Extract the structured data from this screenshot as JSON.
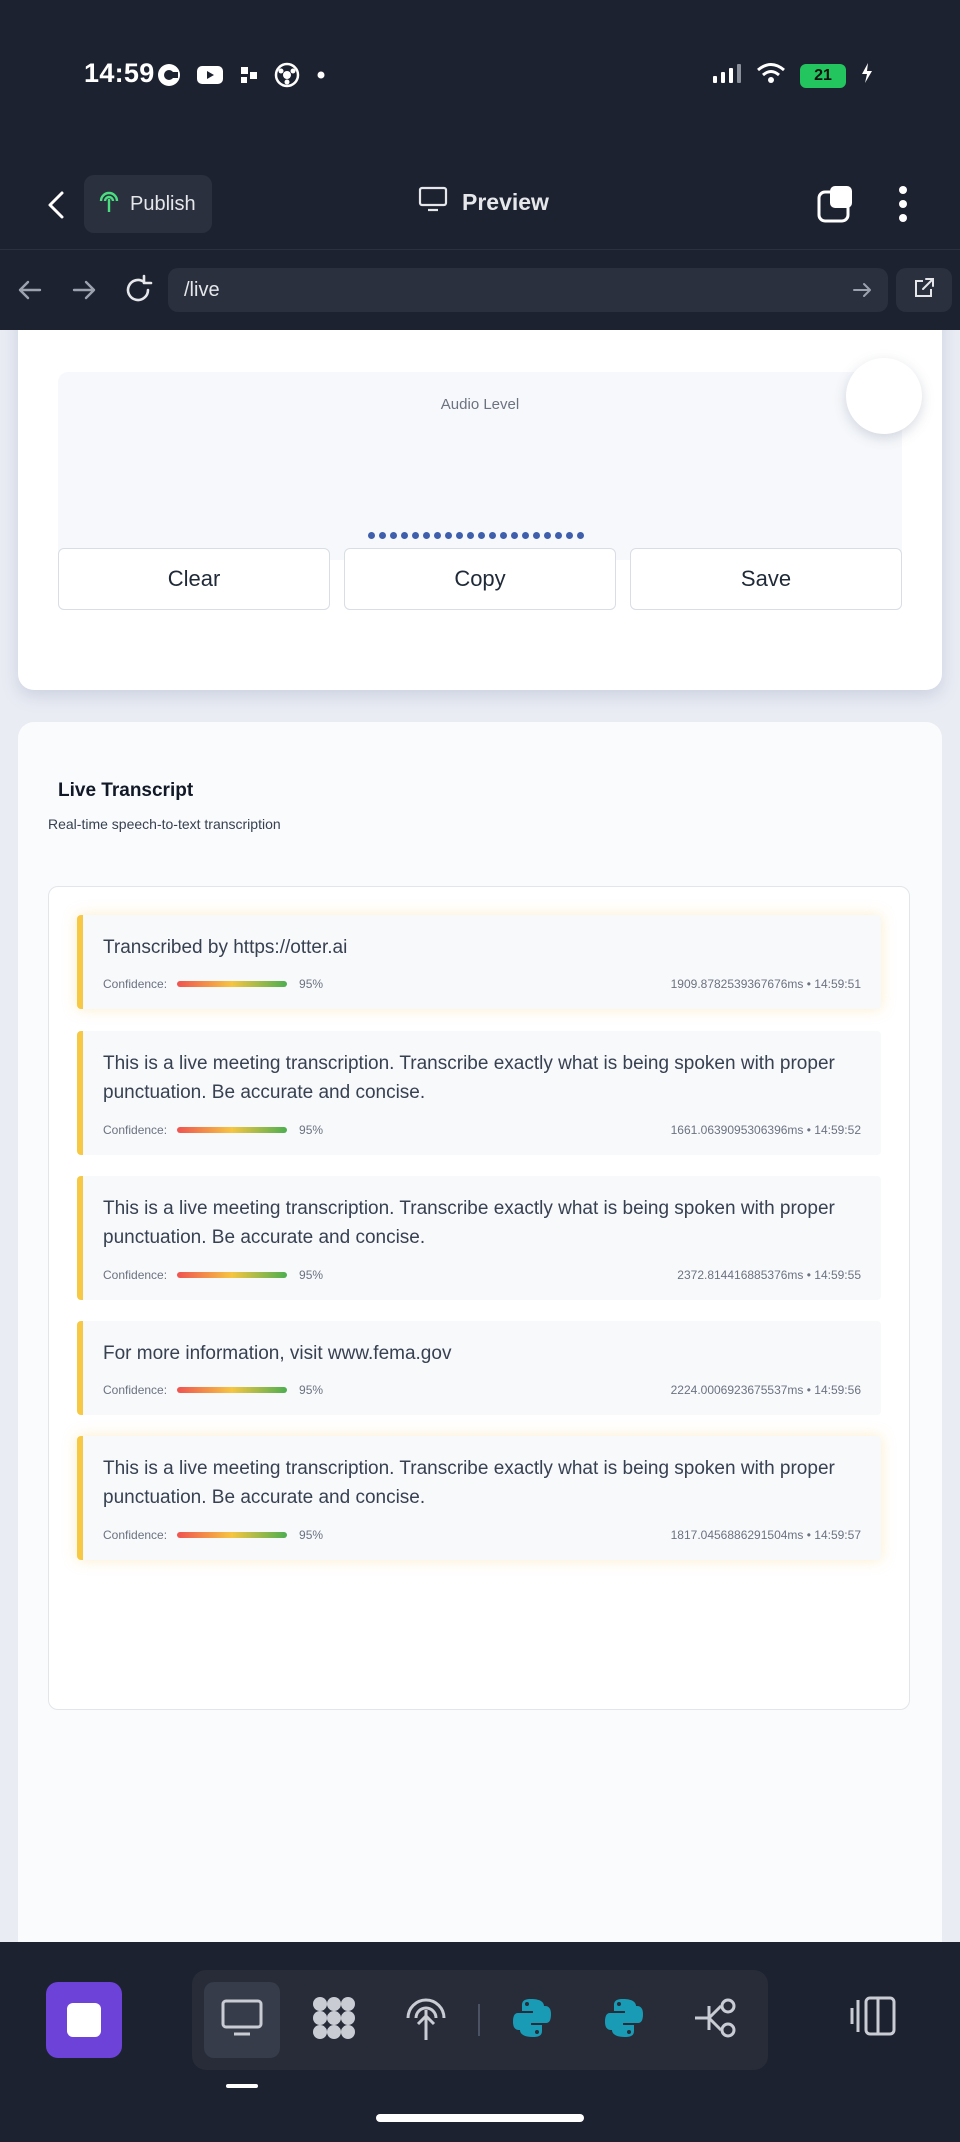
{
  "status_bar": {
    "time": "14:59",
    "battery": "21",
    "icons": [
      "threads-icon",
      "youtube-icon",
      "app-icon",
      "soccer-icon",
      "dot-icon",
      "signal-icon",
      "wifi-icon",
      "battery-icon"
    ]
  },
  "toolbar": {
    "publish_label": "Publish",
    "preview_label": "Preview"
  },
  "browser": {
    "url": "/live"
  },
  "audio": {
    "label": "Audio Level"
  },
  "actions": {
    "clear": "Clear",
    "copy": "Copy",
    "save": "Save"
  },
  "transcript": {
    "title": "Live Transcript",
    "subtitle": "Real-time speech-to-text transcription",
    "confidence_label": "Confidence:",
    "segments": [
      {
        "text": "Transcribed by https://otter.ai",
        "confidence": "95%",
        "meta": "1909.8782539367676ms • 14:59:51"
      },
      {
        "text": "This is a live meeting transcription. Transcribe exactly what is being spoken with proper punctuation. Be accurate and concise.",
        "confidence": "95%",
        "meta": "1661.0639095306396ms • 14:59:52"
      },
      {
        "text": "This is a live meeting transcription. Transcribe exactly what is being spoken with proper punctuation. Be accurate and concise.",
        "confidence": "95%",
        "meta": "2372.814416885376ms • 14:59:55"
      },
      {
        "text": "For more information, visit www.fema.gov",
        "confidence": "95%",
        "meta": "2224.0006923675537ms • 14:59:56"
      },
      {
        "text": "This is a live meeting transcription. Transcribe exactly what is being spoken with proper punctuation. Be accurate and concise.",
        "confidence": "95%",
        "meta": "1817.0456886291504ms • 14:59:57"
      }
    ]
  },
  "colors": {
    "chrome_bg": "#1d2230",
    "accent_purple": "#6d42d9",
    "segment_border": "#f7c843",
    "python_teal": "#1a9bb5"
  }
}
